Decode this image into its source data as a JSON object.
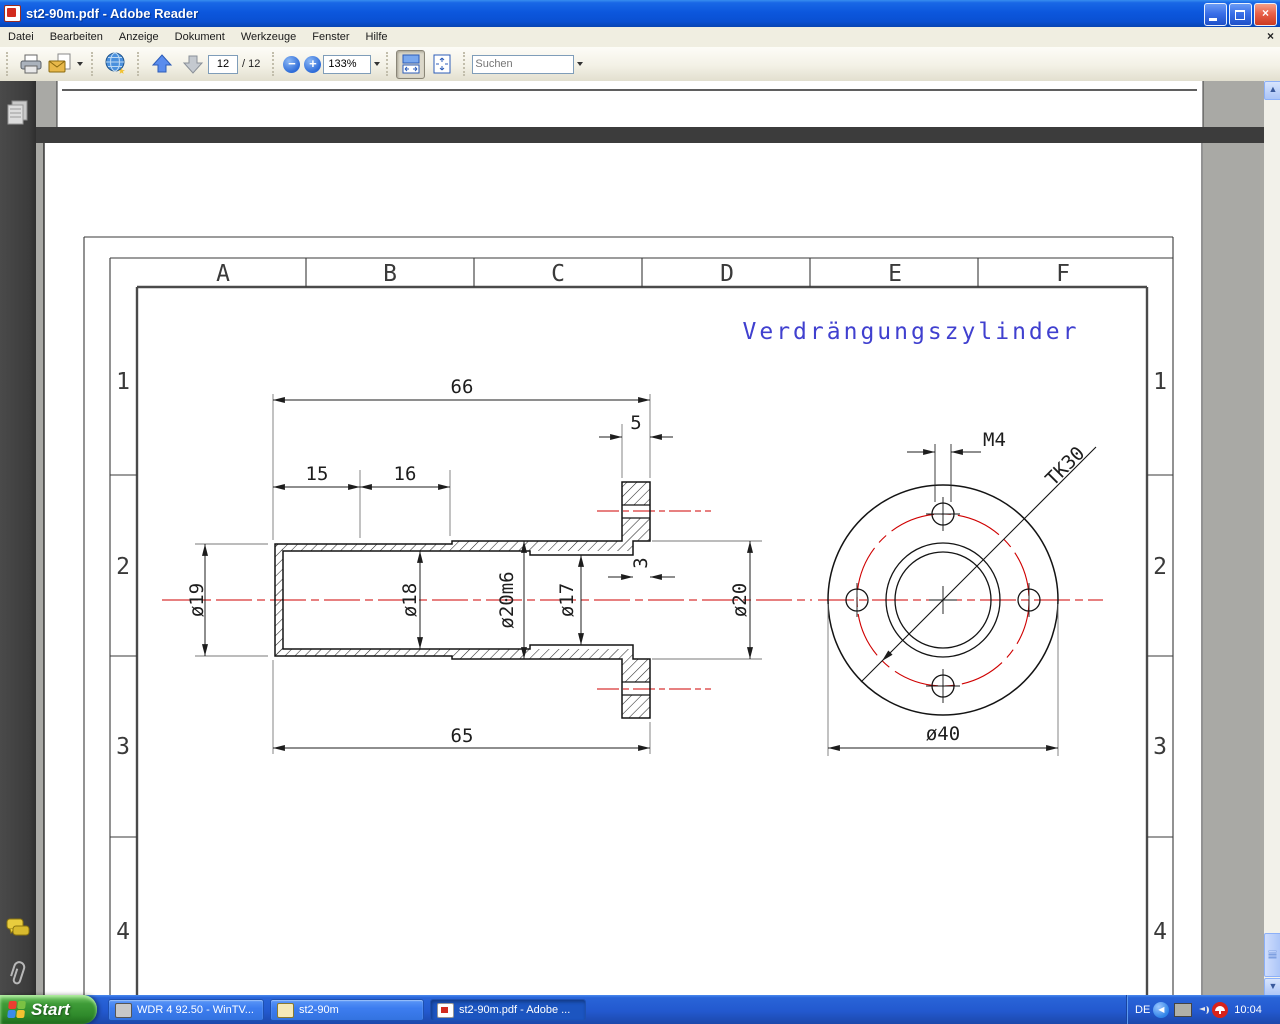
{
  "window": {
    "title": "st2-90m.pdf - Adobe Reader"
  },
  "menu": {
    "items": [
      "Datei",
      "Bearbeiten",
      "Anzeige",
      "Dokument",
      "Werkzeuge",
      "Fenster",
      "Hilfe"
    ]
  },
  "icons": {
    "close_glyph": "×",
    "doc_close_glyph": "×",
    "tray_chevron_glyph": "◀",
    "zoom_out_glyph": "−",
    "zoom_in_glyph": "+",
    "scroll_up_glyph": "▲",
    "scroll_down_glyph": "▼"
  },
  "toolbar": {
    "page_value": "12",
    "page_total": "/ 12",
    "zoom_value": "133%",
    "search_placeholder": "Suchen"
  },
  "document": {
    "sheet": {
      "title": "Verdrängungszylinder",
      "columns": [
        "A",
        "B",
        "C",
        "D",
        "E",
        "F"
      ],
      "rows": [
        "1",
        "2",
        "3",
        "4"
      ]
    },
    "dims": {
      "total_length": "66",
      "flange_width": "5",
      "seg1": "15",
      "seg2": "16",
      "len_to_flange": "65",
      "dia_outer_left": "ø19",
      "dia_bore_left": "ø18",
      "dia_mid": "ø20m6",
      "dia_bore_right": "ø17",
      "counterbore_depth": "3",
      "dia_counterbore": "ø20",
      "thread": "M4",
      "bolt_circle": "TK30",
      "flange_dia": "ø40"
    }
  },
  "taskbar": {
    "start_label": "Start",
    "tasks": [
      {
        "label": "WDR 4 92.50 - WinTV..."
      },
      {
        "label": "st2-90m"
      },
      {
        "label": "st2-90m.pdf - Adobe ..."
      }
    ],
    "tray": {
      "language": "DE",
      "time": "10:04"
    }
  }
}
